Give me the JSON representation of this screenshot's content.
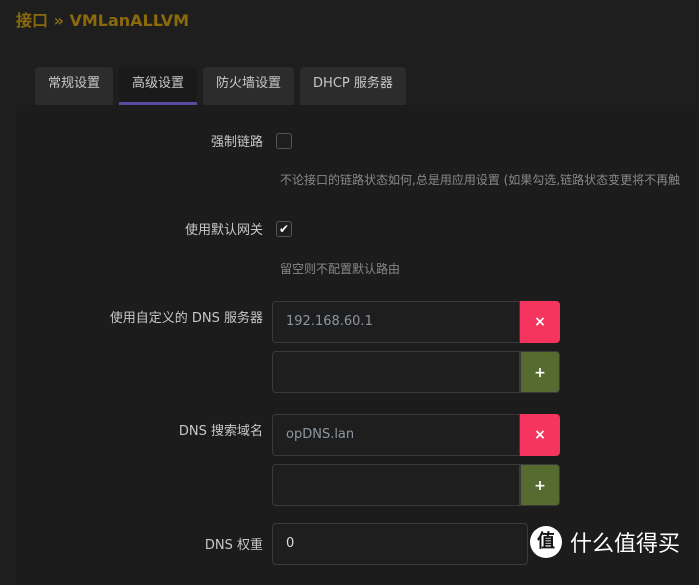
{
  "breadcrumb": "接口 » VMLanALLVM",
  "tabs": [
    "常规设置",
    "高级设置",
    "防火墙设置",
    "DHCP 服务器"
  ],
  "force_link": {
    "label": "强制链路",
    "checked": false,
    "hint": "不论接口的链路状态如何,总是用应用设置 (如果勾选,链路状态变更将不再触"
  },
  "default_gw": {
    "label": "使用默认网关",
    "checked": true,
    "hint": "留空则不配置默认路由"
  },
  "dns_servers": {
    "label": "使用自定义的 DNS 服务器",
    "values": [
      "192.168.60.1",
      ""
    ]
  },
  "dns_search": {
    "label": "DNS 搜索域名",
    "values": [
      "opDNS.lan",
      ""
    ]
  },
  "dns_weight": {
    "label": "DNS 权重",
    "value": "0"
  },
  "buttons": {
    "remove": "×",
    "add": "+"
  },
  "check_mark": "✔",
  "watermark": {
    "icon": "值",
    "text": "什么值得买"
  }
}
